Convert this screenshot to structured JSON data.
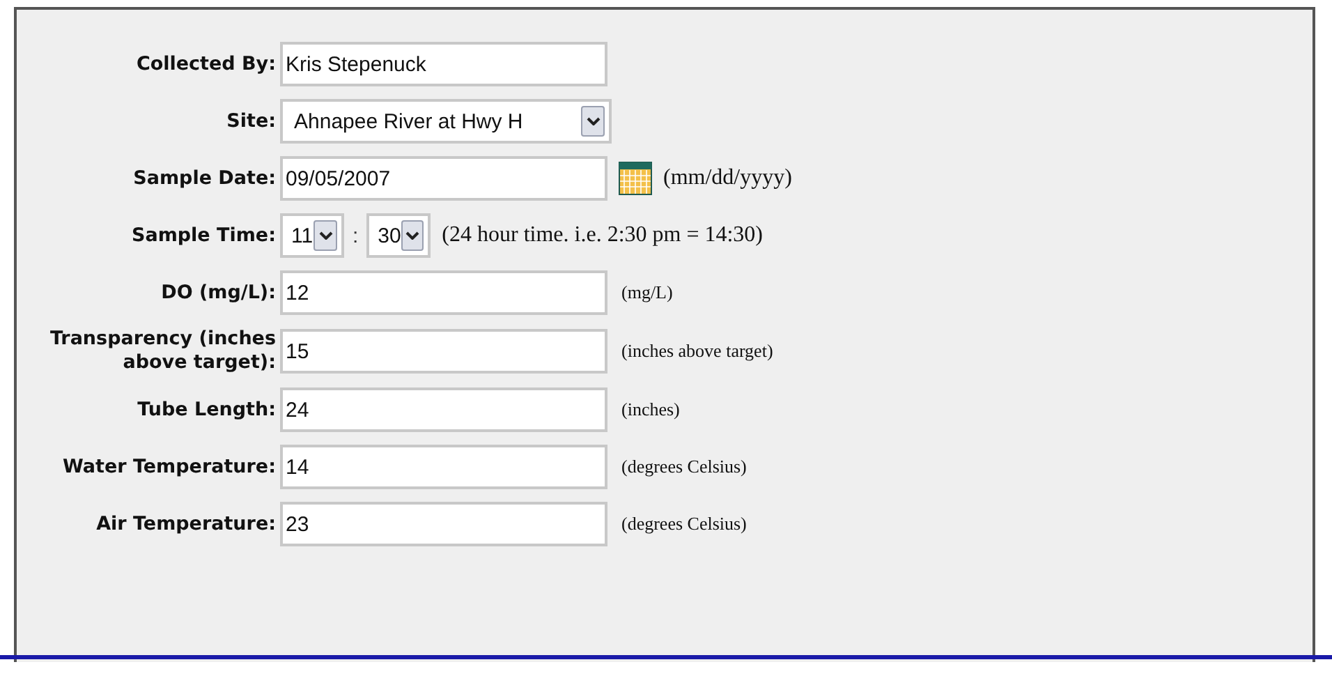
{
  "fields": [
    {
      "kind": "text",
      "label": "Collected By:",
      "value": "Kris Stepenuck"
    },
    {
      "kind": "select",
      "label": "Site:",
      "value": "Ahnapee River at Hwy H"
    },
    {
      "kind": "date",
      "label": "Sample Date:",
      "value": "09/05/2007",
      "hint": "(mm/dd/yyyy)"
    },
    {
      "kind": "time",
      "label": "Sample Time:",
      "hour": "11",
      "separator": ":",
      "minute": "30",
      "hint": "(24 hour time. i.e. 2:30 pm = 14:30)"
    },
    {
      "kind": "text",
      "label": "DO (mg/L):",
      "value": "12",
      "hint": "(mg/L)"
    },
    {
      "kind": "text",
      "label": "Transparency (inches above target):",
      "value": "15",
      "hint": "(inches above target)"
    },
    {
      "kind": "text",
      "label": "Tube Length:",
      "value": "24",
      "hint": "(inches)"
    },
    {
      "kind": "text",
      "label": "Water Temperature:",
      "value": "14",
      "hint": "(degrees Celsius)"
    },
    {
      "kind": "text",
      "label": "Air Temperature:",
      "value": "23",
      "hint": "(degrees Celsius)"
    }
  ]
}
